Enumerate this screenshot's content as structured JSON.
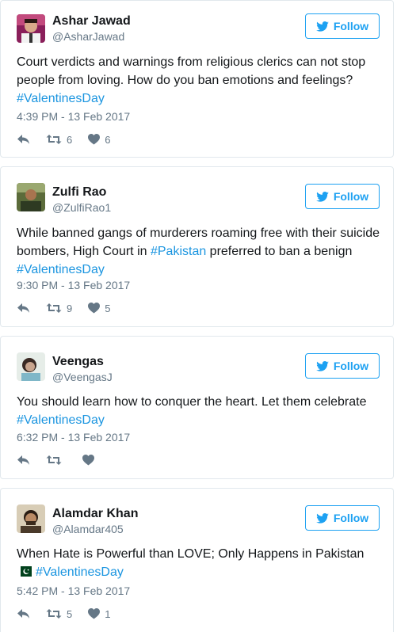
{
  "icons": {
    "bird": "twitter-bird-icon",
    "reply": "reply-icon",
    "retweet": "retweet-icon",
    "like": "heart-icon",
    "flag": "pakistan-flag-icon"
  },
  "colors": {
    "accent": "#1da1f2",
    "link": "#1b95e0",
    "muted": "#657786"
  },
  "tweets": [
    {
      "name": "Ashar Jawad",
      "handle": "@AsharJawad",
      "follow": "Follow",
      "text1": "Court verdicts and warnings from religious clerics can not stop people from loving. How do you ban emotions and feelings? ",
      "hashtag": "#ValentinesDay",
      "time": "4:39 PM - 13 Feb 2017",
      "retweets": "6",
      "likes": "6"
    },
    {
      "name": "Zulfi Rao",
      "handle": "@ZulfiRao1",
      "follow": "Follow",
      "text1": "While banned gangs of murderers roaming free with their suicide bombers, High Court in ",
      "hashtag_mid": "#Pakistan",
      "text2": " preferred to ban a benign ",
      "hashtag": "#ValentinesDay",
      "time": "9:30 PM - 13 Feb 2017",
      "retweets": "9",
      "likes": "5"
    },
    {
      "name": "Veengas",
      "handle": "@VeengasJ",
      "follow": "Follow",
      "text1": "You should learn how to conquer the heart. Let them celebrate ",
      "hashtag": "#ValentinesDay",
      "time": "6:32 PM - 13 Feb 2017",
      "retweets": "",
      "likes": ""
    },
    {
      "name": "Alamdar Khan",
      "handle": "@Alamdar405",
      "follow": "Follow",
      "text1": "When Hate is Powerful than LOVE; Only Happens in Pakistan ",
      "hashtag": "#ValentinesDay",
      "time": "5:42 PM - 13 Feb 2017",
      "retweets": "5",
      "likes": "1"
    }
  ]
}
